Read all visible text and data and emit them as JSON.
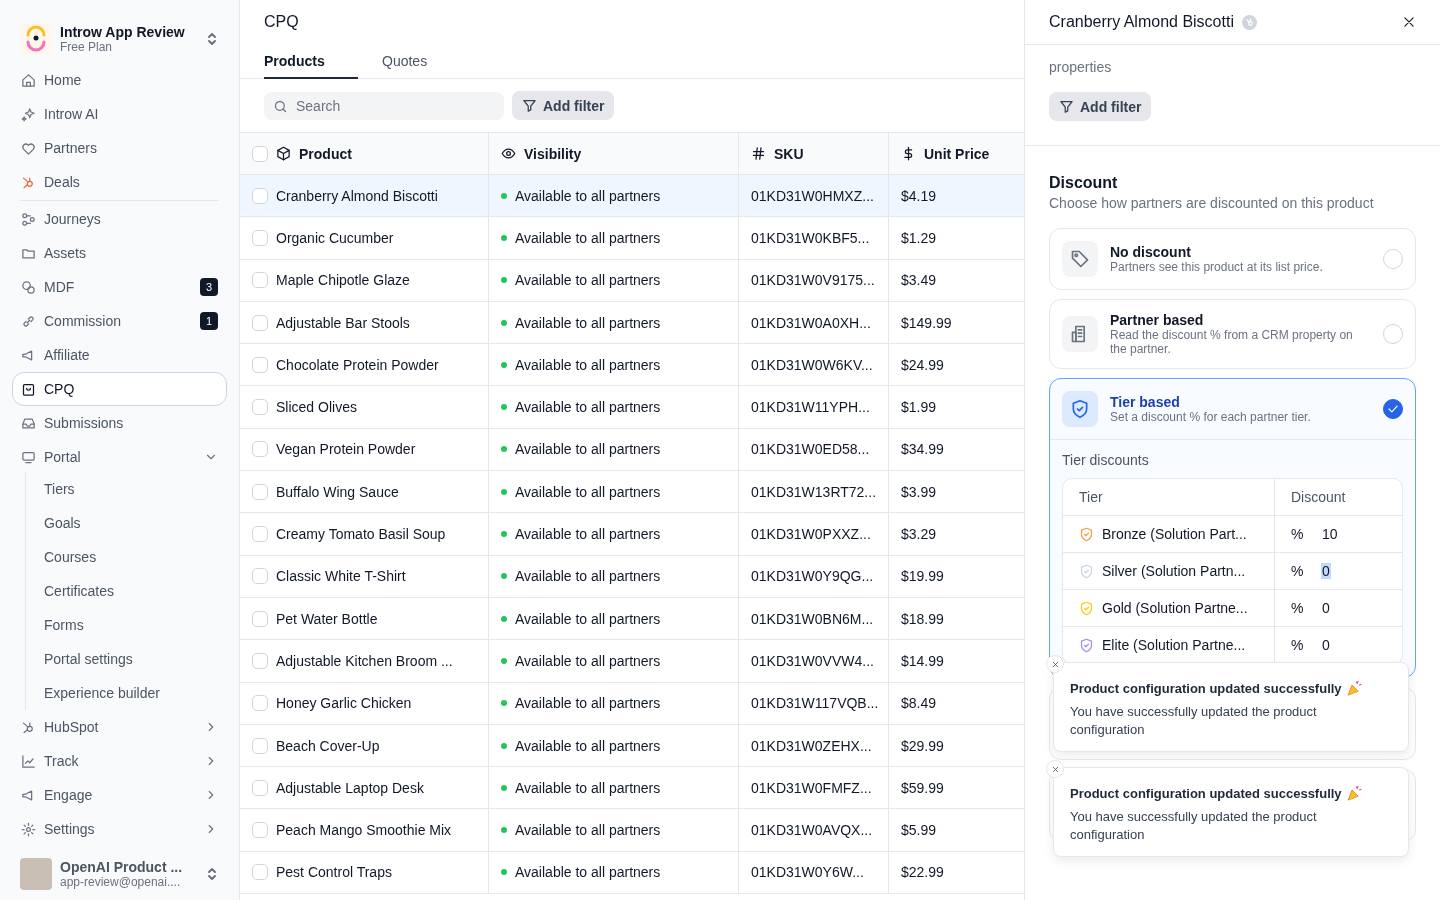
{
  "workspace": {
    "name": "Introw App Review",
    "plan": "Free Plan"
  },
  "sidebar": {
    "sections": [
      {
        "items": [
          {
            "label": "Home",
            "selected": false
          },
          {
            "label": "Introw AI",
            "selected": false
          },
          {
            "label": "Partners",
            "selected": false
          },
          {
            "label": "Deals",
            "selected": false
          }
        ]
      },
      {
        "items": [
          {
            "label": "Journeys",
            "selected": false
          },
          {
            "label": "Assets",
            "selected": false
          },
          {
            "label": "MDF",
            "selected": false,
            "badge": "3"
          },
          {
            "label": "Commission",
            "selected": false,
            "badge": "1"
          },
          {
            "label": "Affiliate",
            "selected": false
          },
          {
            "label": "CPQ",
            "selected": true
          },
          {
            "label": "Submissions",
            "selected": false
          },
          {
            "label": "Portal",
            "selected": false,
            "expanded": true,
            "children": [
              {
                "label": "Tiers",
                "selected": false
              },
              {
                "label": "Goals",
                "selected": false
              },
              {
                "label": "Courses",
                "selected": false
              },
              {
                "label": "Certificates",
                "selected": false
              },
              {
                "label": "Forms",
                "selected": false
              },
              {
                "label": "Portal settings",
                "selected": false
              },
              {
                "label": "Experience builder",
                "selected": false
              }
            ]
          },
          {
            "label": "HubSpot",
            "selected": false,
            "expanded": false
          },
          {
            "label": "Track",
            "selected": false,
            "expanded": false
          },
          {
            "label": "Engage",
            "selected": false,
            "expanded": false
          },
          {
            "label": "Settings",
            "selected": false,
            "expanded": false
          }
        ]
      }
    ]
  },
  "user": {
    "name": "OpenAI Product ...",
    "email": "app-review@openai...."
  },
  "page": {
    "title": "CPQ"
  },
  "tabs": [
    {
      "label": "Products",
      "selected": true
    },
    {
      "label": "Quotes",
      "selected": false
    }
  ],
  "search": {
    "placeholder": "Search"
  },
  "filter_button": "Add filter",
  "table": {
    "all_checked": false,
    "columns": [
      "Product",
      "Visibility",
      "SKU",
      "Unit Price"
    ],
    "rows": [
      {
        "product": "Cranberry Almond Biscotti",
        "visibility": "Available to all partners",
        "sku": "01KD31W0HMXZ...",
        "price": "$4.19",
        "selected": true,
        "checked": false
      },
      {
        "product": "Organic Cucumber",
        "visibility": "Available to all partners",
        "sku": "01KD31W0KBF5...",
        "price": "$1.29",
        "selected": false,
        "checked": false
      },
      {
        "product": "Maple Chipotle Glaze",
        "visibility": "Available to all partners",
        "sku": "01KD31W0V9175...",
        "price": "$3.49",
        "selected": false,
        "checked": false
      },
      {
        "product": "Adjustable Bar Stools",
        "visibility": "Available to all partners",
        "sku": "01KD31W0A0XH...",
        "price": "$149.99",
        "selected": false,
        "checked": false
      },
      {
        "product": "Chocolate Protein Powder",
        "visibility": "Available to all partners",
        "sku": "01KD31W0W6KV...",
        "price": "$24.99",
        "selected": false,
        "checked": false
      },
      {
        "product": "Sliced Olives",
        "visibility": "Available to all partners",
        "sku": "01KD31W11YPH...",
        "price": "$1.99",
        "selected": false,
        "checked": false
      },
      {
        "product": "Vegan Protein Powder",
        "visibility": "Available to all partners",
        "sku": "01KD31W0ED58...",
        "price": "$34.99",
        "selected": false,
        "checked": false
      },
      {
        "product": "Buffalo Wing Sauce",
        "visibility": "Available to all partners",
        "sku": "01KD31W13RT72...",
        "price": "$3.99",
        "selected": false,
        "checked": false
      },
      {
        "product": "Creamy Tomato Basil Soup",
        "visibility": "Available to all partners",
        "sku": "01KD31W0PXXZ...",
        "price": "$3.29",
        "selected": false,
        "checked": false
      },
      {
        "product": "Classic White T-Shirt",
        "visibility": "Available to all partners",
        "sku": "01KD31W0Y9QG...",
        "price": "$19.99",
        "selected": false,
        "checked": false
      },
      {
        "product": "Pet Water Bottle",
        "visibility": "Available to all partners",
        "sku": "01KD31W0BN6M...",
        "price": "$18.99",
        "selected": false,
        "checked": false
      },
      {
        "product": "Adjustable Kitchen Broom ...",
        "visibility": "Available to all partners",
        "sku": "01KD31W0VVW4...",
        "price": "$14.99",
        "selected": false,
        "checked": false
      },
      {
        "product": "Honey Garlic Chicken",
        "visibility": "Available to all partners",
        "sku": "01KD31W117VQB...",
        "price": "$8.49",
        "selected": false,
        "checked": false
      },
      {
        "product": "Beach Cover-Up",
        "visibility": "Available to all partners",
        "sku": "01KD31W0ZEHX...",
        "price": "$29.99",
        "selected": false,
        "checked": false
      },
      {
        "product": "Adjustable Laptop Desk",
        "visibility": "Available to all partners",
        "sku": "01KD31W0FMFZ...",
        "price": "$59.99",
        "selected": false,
        "checked": false
      },
      {
        "product": "Peach Mango Smoothie Mix",
        "visibility": "Available to all partners",
        "sku": "01KD31W0AVQX...",
        "price": "$5.99",
        "selected": false,
        "checked": false
      },
      {
        "product": "Pest Control Traps",
        "visibility": "Available to all partners",
        "sku": "01KD31W0Y6W...",
        "price": "$22.99",
        "selected": false,
        "checked": false
      }
    ]
  },
  "panel": {
    "title": "Cranberry Almond Biscotti",
    "description_tail": "properties",
    "filter_button": "Add filter",
    "discount": {
      "title": "Discount",
      "subtitle": "Choose how partners are discounted on this product",
      "options": [
        {
          "title": "No discount",
          "description": "Partners see this product at its list price.",
          "selected": false
        },
        {
          "title": "Partner based",
          "description": "Read the discount % from a CRM property on the partner.",
          "selected": false
        },
        {
          "title": "Tier based",
          "description": "Set a discount % for each partner tier.",
          "selected": true
        }
      ],
      "tier_discounts": {
        "title": "Tier discounts",
        "columns": [
          "Tier",
          "Discount"
        ],
        "rows": [
          {
            "tier": "Bronze (Solution Part...",
            "color": "#f59e4b",
            "unit": "%",
            "value": "10",
            "value_selected": false
          },
          {
            "tier": "Silver (Solution Partn...",
            "color": "#cbd5e1",
            "unit": "%",
            "value": "0",
            "value_selected": true
          },
          {
            "tier": "Gold (Solution Partne...",
            "color": "#facc15",
            "unit": "%",
            "value": "0",
            "value_selected": false
          },
          {
            "tier": "Elite (Solution Partne...",
            "color": "#a78bfa",
            "unit": "%",
            "value": "0",
            "value_selected": false
          }
        ]
      }
    }
  },
  "toasts": [
    {
      "title": "Product configuration updated successfully",
      "message": "You have successfully updated the product configuration"
    },
    {
      "title": "Product configuration updated successfully",
      "message": "You have successfully updated the product configuration"
    }
  ]
}
